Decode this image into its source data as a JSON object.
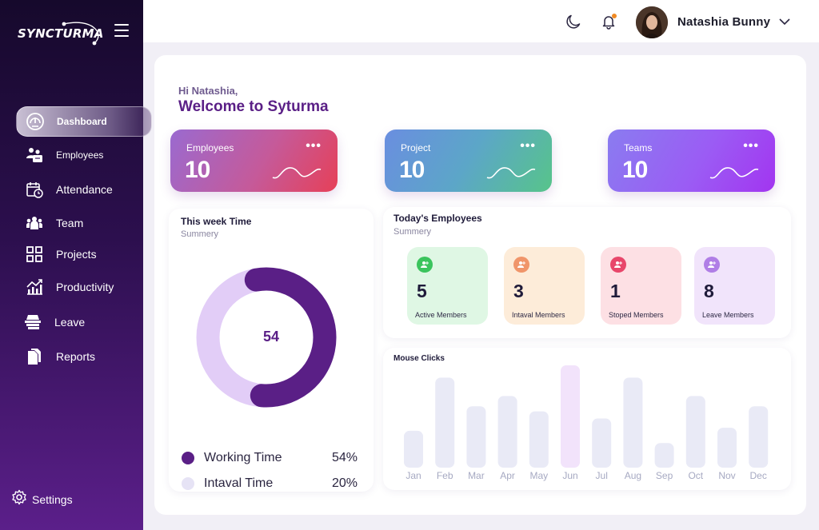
{
  "app": {
    "logo_text": "SYNCTURMA"
  },
  "sidebar": {
    "items": [
      {
        "label": "Dashboard",
        "icon": "gauge-icon",
        "active": true
      },
      {
        "label": "Employees",
        "icon": "users-icon"
      },
      {
        "label": "Attendance",
        "icon": "calendar-icon"
      },
      {
        "label": "Team",
        "icon": "team-icon"
      },
      {
        "label": "Projects",
        "icon": "grid-icon"
      },
      {
        "label": "Productivity",
        "icon": "chart-up-icon"
      },
      {
        "label": "Leave",
        "icon": "leave-icon"
      },
      {
        "label": "Reports",
        "icon": "document-icon"
      }
    ],
    "settings_label": "Settings"
  },
  "topbar": {
    "user_name": "Natashia Bunny"
  },
  "greeting": {
    "small": "Hi Natashia,",
    "big": "Welcome to Syturma"
  },
  "stat_cards": [
    {
      "title": "Employees",
      "value": "10",
      "menu": "•••"
    },
    {
      "title": "Project",
      "value": "10",
      "menu": "•••"
    },
    {
      "title": "Teams",
      "value": "10",
      "menu": "•••"
    }
  ],
  "week_time": {
    "title": "This week Time",
    "subtitle": "Summery",
    "center_value": "54",
    "working_fraction": 0.54,
    "legend": [
      {
        "label": "Working Time",
        "value": "54%",
        "color": "#5a1f86"
      },
      {
        "label": "Intaval Time",
        "value": "20%",
        "color": "#e6e3f5"
      }
    ]
  },
  "today": {
    "title": "Today's Employees",
    "subtitle": "Summery",
    "cards": [
      {
        "value": "5",
        "label": "Active Members",
        "bg": "#dff7e4",
        "icon_bg": "#3bc45d"
      },
      {
        "value": "3",
        "label": "Intaval Members",
        "bg": "#fdecd9",
        "icon_bg": "#f0956a"
      },
      {
        "value": "1",
        "label": "Stoped Members",
        "bg": "#fde0e4",
        "icon_bg": "#e8466a"
      },
      {
        "value": "8",
        "label": "Leave Members",
        "bg": "#f1e4fb",
        "icon_bg": "#b07ee6"
      }
    ]
  },
  "chart_data": {
    "type": "bar",
    "title": "Mouse Clicks",
    "categories": [
      "Jan",
      "Feb",
      "Mar",
      "Apr",
      "May",
      "Jun",
      "Jul",
      "Aug",
      "Sep",
      "Oct",
      "Nov",
      "Dec"
    ],
    "values": [
      36,
      88,
      60,
      70,
      55,
      100,
      48,
      88,
      24,
      70,
      39,
      60
    ],
    "highlight": "Jun",
    "bar_color": "#e9eaf6",
    "highlight_color": "#f2e3fb",
    "grid": false
  }
}
